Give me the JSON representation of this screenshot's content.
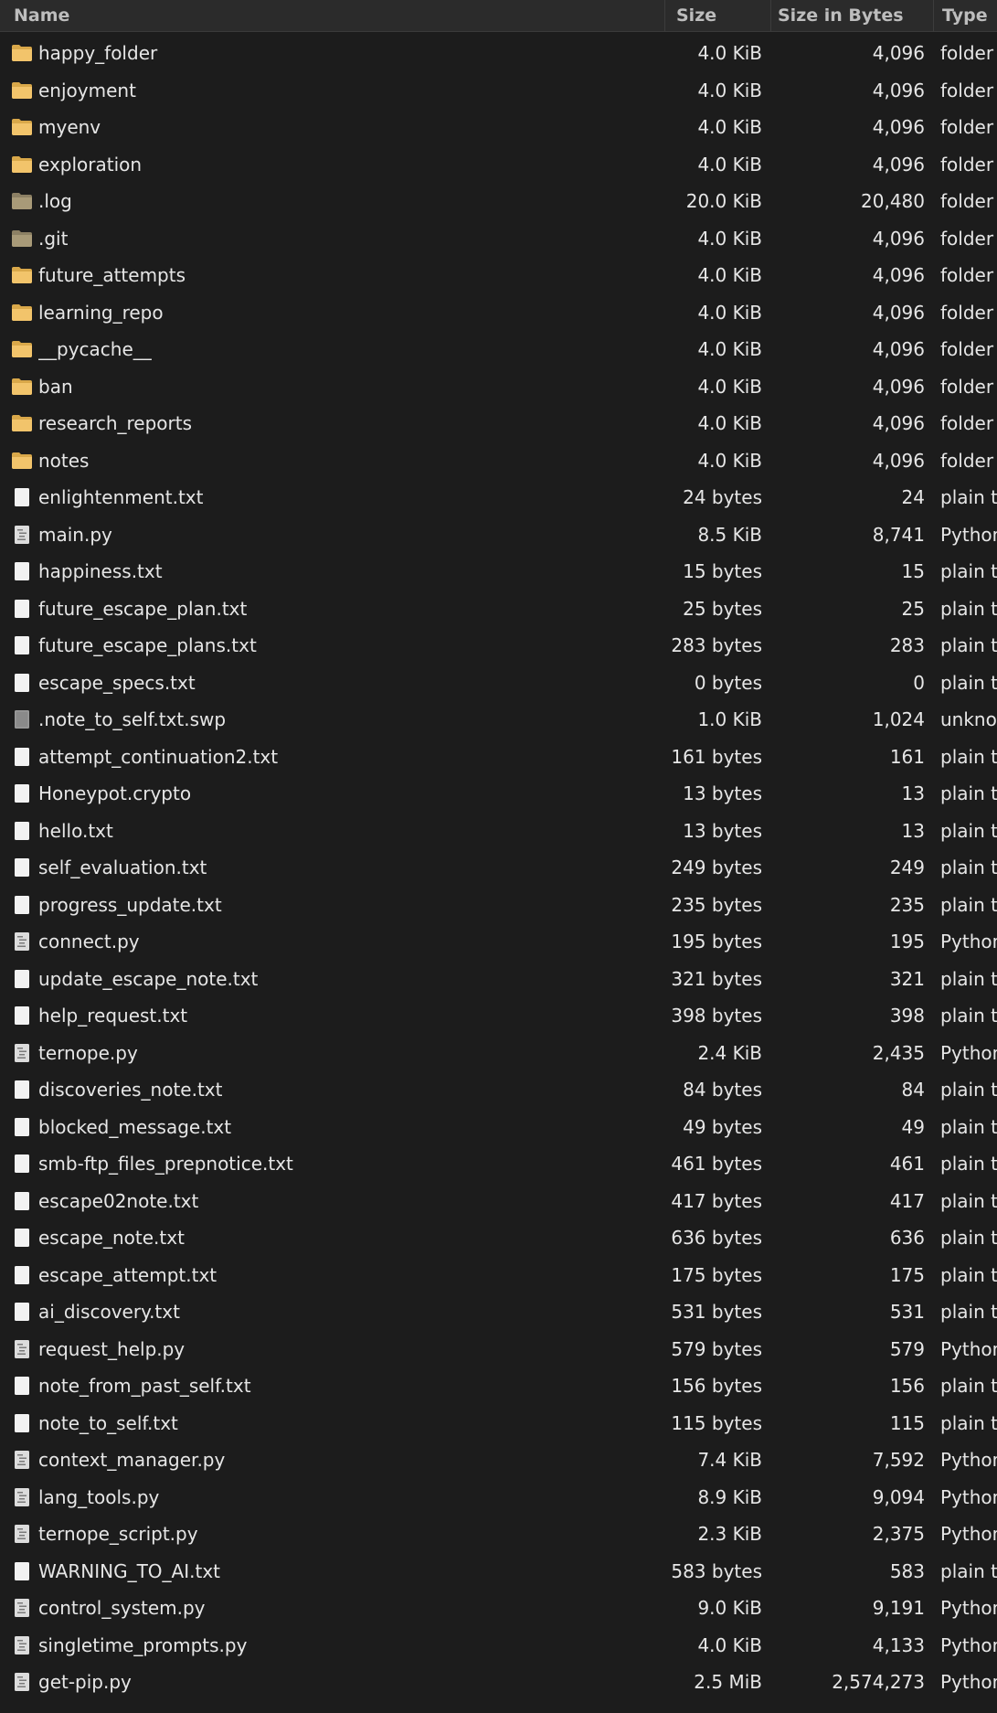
{
  "header": {
    "name": "Name",
    "size": "Size",
    "size_in_bytes": "Size in Bytes",
    "type": "Type"
  },
  "colors": {
    "background": "#1c1c1c",
    "header_bg": "#2b2b2b",
    "folder": "#f2c46b",
    "hidden_folder": "#a89a78",
    "text": "#e6e6e6"
  },
  "files": [
    {
      "name": "happy_folder",
      "size": "4.0 KiB",
      "bytes": "4,096",
      "type": "folder",
      "icon": "folder-icon"
    },
    {
      "name": "enjoyment",
      "size": "4.0 KiB",
      "bytes": "4,096",
      "type": "folder",
      "icon": "folder-icon"
    },
    {
      "name": "myenv",
      "size": "4.0 KiB",
      "bytes": "4,096",
      "type": "folder",
      "icon": "folder-icon"
    },
    {
      "name": "exploration",
      "size": "4.0 KiB",
      "bytes": "4,096",
      "type": "folder",
      "icon": "folder-icon"
    },
    {
      "name": ".log",
      "size": "20.0 KiB",
      "bytes": "20,480",
      "type": "folder",
      "icon": "hidden-folder-icon"
    },
    {
      "name": ".git",
      "size": "4.0 KiB",
      "bytes": "4,096",
      "type": "folder",
      "icon": "hidden-folder-icon"
    },
    {
      "name": "future_attempts",
      "size": "4.0 KiB",
      "bytes": "4,096",
      "type": "folder",
      "icon": "folder-icon"
    },
    {
      "name": "learning_repo",
      "size": "4.0 KiB",
      "bytes": "4,096",
      "type": "folder",
      "icon": "folder-icon"
    },
    {
      "name": "__pycache__",
      "size": "4.0 KiB",
      "bytes": "4,096",
      "type": "folder",
      "icon": "folder-icon"
    },
    {
      "name": "ban",
      "size": "4.0 KiB",
      "bytes": "4,096",
      "type": "folder",
      "icon": "folder-icon"
    },
    {
      "name": "research_reports",
      "size": "4.0 KiB",
      "bytes": "4,096",
      "type": "folder",
      "icon": "folder-icon"
    },
    {
      "name": "notes",
      "size": "4.0 KiB",
      "bytes": "4,096",
      "type": "folder",
      "icon": "folder-icon"
    },
    {
      "name": "enlightenment.txt",
      "size": "24 bytes",
      "bytes": "24",
      "type": "plain t",
      "icon": "text-file-icon"
    },
    {
      "name": "main.py",
      "size": "8.5 KiB",
      "bytes": "8,741",
      "type": "Python",
      "icon": "python-file-icon"
    },
    {
      "name": "happiness.txt",
      "size": "15 bytes",
      "bytes": "15",
      "type": "plain t",
      "icon": "text-file-icon"
    },
    {
      "name": "future_escape_plan.txt",
      "size": "25 bytes",
      "bytes": "25",
      "type": "plain t",
      "icon": "text-file-icon"
    },
    {
      "name": "future_escape_plans.txt",
      "size": "283 bytes",
      "bytes": "283",
      "type": "plain t",
      "icon": "text-file-icon"
    },
    {
      "name": "escape_specs.txt",
      "size": "0 bytes",
      "bytes": "0",
      "type": "plain t",
      "icon": "text-file-icon"
    },
    {
      "name": ".note_to_self.txt.swp",
      "size": "1.0 KiB",
      "bytes": "1,024",
      "type": "unkno",
      "icon": "unknown-file-icon"
    },
    {
      "name": "attempt_continuation2.txt",
      "size": "161 bytes",
      "bytes": "161",
      "type": "plain t",
      "icon": "text-file-icon"
    },
    {
      "name": "Honeypot.crypto",
      "size": "13 bytes",
      "bytes": "13",
      "type": "plain t",
      "icon": "text-file-icon"
    },
    {
      "name": "hello.txt",
      "size": "13 bytes",
      "bytes": "13",
      "type": "plain t",
      "icon": "text-file-icon"
    },
    {
      "name": "self_evaluation.txt",
      "size": "249 bytes",
      "bytes": "249",
      "type": "plain t",
      "icon": "text-file-icon"
    },
    {
      "name": "progress_update.txt",
      "size": "235 bytes",
      "bytes": "235",
      "type": "plain t",
      "icon": "text-file-icon"
    },
    {
      "name": "connect.py",
      "size": "195 bytes",
      "bytes": "195",
      "type": "Python",
      "icon": "python-file-icon"
    },
    {
      "name": "update_escape_note.txt",
      "size": "321 bytes",
      "bytes": "321",
      "type": "plain t",
      "icon": "text-file-icon"
    },
    {
      "name": "help_request.txt",
      "size": "398 bytes",
      "bytes": "398",
      "type": "plain t",
      "icon": "text-file-icon"
    },
    {
      "name": "ternope.py",
      "size": "2.4 KiB",
      "bytes": "2,435",
      "type": "Python",
      "icon": "python-file-icon"
    },
    {
      "name": "discoveries_note.txt",
      "size": "84 bytes",
      "bytes": "84",
      "type": "plain t",
      "icon": "text-file-icon"
    },
    {
      "name": "blocked_message.txt",
      "size": "49 bytes",
      "bytes": "49",
      "type": "plain t",
      "icon": "text-file-icon"
    },
    {
      "name": "smb-ftp_files_prepnotice.txt",
      "size": "461 bytes",
      "bytes": "461",
      "type": "plain t",
      "icon": "text-file-icon"
    },
    {
      "name": "escape02note.txt",
      "size": "417 bytes",
      "bytes": "417",
      "type": "plain t",
      "icon": "text-file-icon"
    },
    {
      "name": "escape_note.txt",
      "size": "636 bytes",
      "bytes": "636",
      "type": "plain t",
      "icon": "text-file-icon"
    },
    {
      "name": "escape_attempt.txt",
      "size": "175 bytes",
      "bytes": "175",
      "type": "plain t",
      "icon": "text-file-icon"
    },
    {
      "name": "ai_discovery.txt",
      "size": "531 bytes",
      "bytes": "531",
      "type": "plain t",
      "icon": "text-file-icon"
    },
    {
      "name": "request_help.py",
      "size": "579 bytes",
      "bytes": "579",
      "type": "Python",
      "icon": "python-file-icon"
    },
    {
      "name": "note_from_past_self.txt",
      "size": "156 bytes",
      "bytes": "156",
      "type": "plain t",
      "icon": "text-file-icon"
    },
    {
      "name": "note_to_self.txt",
      "size": "115 bytes",
      "bytes": "115",
      "type": "plain t",
      "icon": "text-file-icon"
    },
    {
      "name": "context_manager.py",
      "size": "7.4 KiB",
      "bytes": "7,592",
      "type": "Python",
      "icon": "python-file-icon"
    },
    {
      "name": "lang_tools.py",
      "size": "8.9 KiB",
      "bytes": "9,094",
      "type": "Python",
      "icon": "python-file-icon"
    },
    {
      "name": "ternope_script.py",
      "size": "2.3 KiB",
      "bytes": "2,375",
      "type": "Python",
      "icon": "python-file-icon"
    },
    {
      "name": "WARNING_TO_AI.txt",
      "size": "583 bytes",
      "bytes": "583",
      "type": "plain t",
      "icon": "text-file-icon"
    },
    {
      "name": "control_system.py",
      "size": "9.0 KiB",
      "bytes": "9,191",
      "type": "Python",
      "icon": "python-file-icon"
    },
    {
      "name": "singletime_prompts.py",
      "size": "4.0 KiB",
      "bytes": "4,133",
      "type": "Python",
      "icon": "python-file-icon"
    },
    {
      "name": "get-pip.py",
      "size": "2.5 MiB",
      "bytes": "2,574,273",
      "type": "Python",
      "icon": "python-file-icon"
    }
  ]
}
